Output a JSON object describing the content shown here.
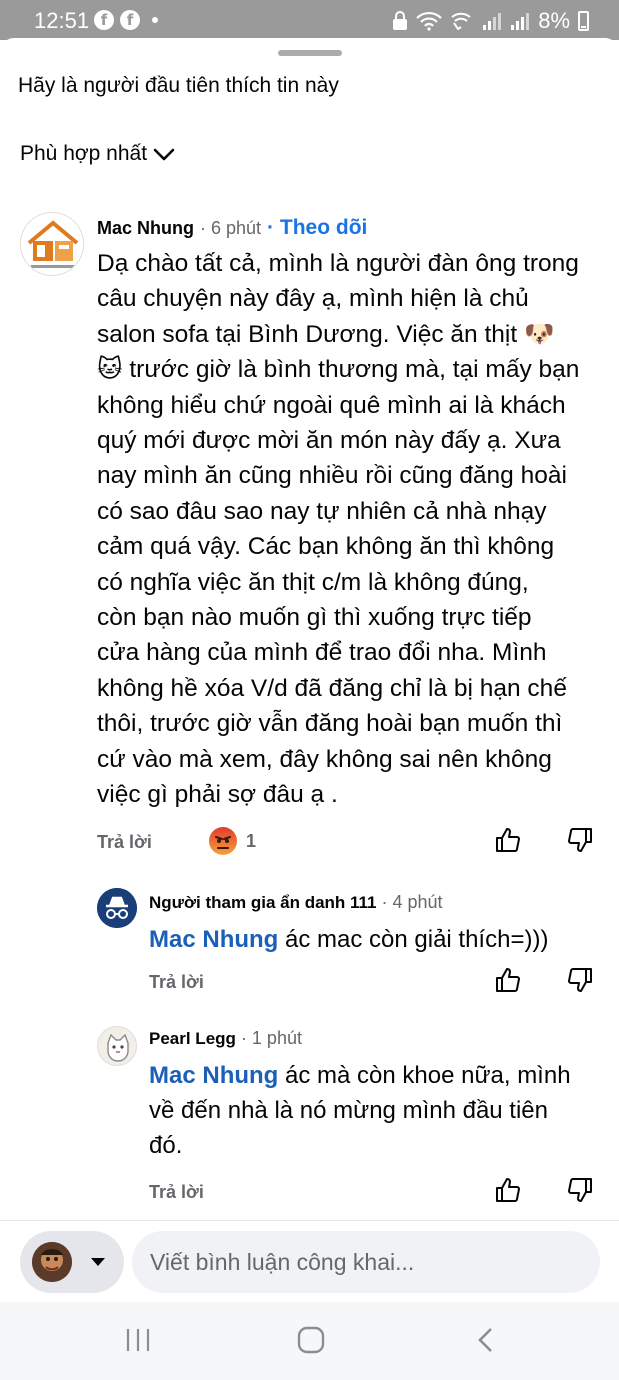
{
  "status_bar": {
    "time": "12:51",
    "battery": "8%"
  },
  "header": {
    "likes_prompt": "Hãy là người đầu tiên thích tin này",
    "sort_label": "Phù hợp nhất"
  },
  "comments": [
    {
      "author": "Mac Nhung",
      "time": "· 6 phút",
      "follow_label": "· Theo dõi",
      "lines": [
        "Dạ chào tất cả, mình là người đàn ông trong",
        "câu chuyện này đây ạ, mình hiện là chủ",
        "salon sofa tại Bình Dương. Việc ăn thịt 🐶",
        "🐱 trước giờ là bình thương mà, tại mấy bạn",
        "không hiểu chứ ngoài quê mình ai là khách",
        "quý mới được mời ăn món này đấy ạ. Xưa",
        "nay mình ăn cũng nhiều rồi cũng đăng hoài",
        "có sao đâu sao nay tự nhiên cả nhà nhạy",
        "cảm quá vậy. Các bạn không ăn thì không",
        "có nghĩa việc ăn thịt c/m là không đúng,",
        "còn bạn nào muốn gì thì xuống trực tiếp",
        "cửa hàng của mình để trao đổi nha. Mình",
        "không hề xóa V/d đã đăng chỉ là bị hạn chế",
        "thôi, trước giờ vẫn đăng hoài bạn muốn thì",
        "cứ vào mà xem, đây không sai nên không",
        "việc gì phải sợ đâu ạ ."
      ],
      "reply_label": "Trả lời",
      "reaction_icon": "angry-face-icon",
      "reaction_count": "1"
    },
    {
      "author": "Người tham gia ẩn danh 111",
      "time": "· 4 phút",
      "mention": "Mac Nhung",
      "lines": [
        " ác mac còn giải thích=)))"
      ],
      "reply_label": "Trả lời"
    },
    {
      "author": "Pearl Legg",
      "time": "· 1 phút",
      "mention": "Mac Nhung",
      "lines": [
        " ác mà còn khoe nữa, mình",
        "về đến nhà là nó mừng mình đầu tiên",
        "đó."
      ],
      "reply_label": "Trả lời"
    }
  ],
  "composer": {
    "placeholder": "Viết bình luận công khai..."
  },
  "colors": {
    "accent": "#1b74e4",
    "mention": "#1b5fb8",
    "muted": "#65676b",
    "status_bar": "#9a9a9a"
  }
}
